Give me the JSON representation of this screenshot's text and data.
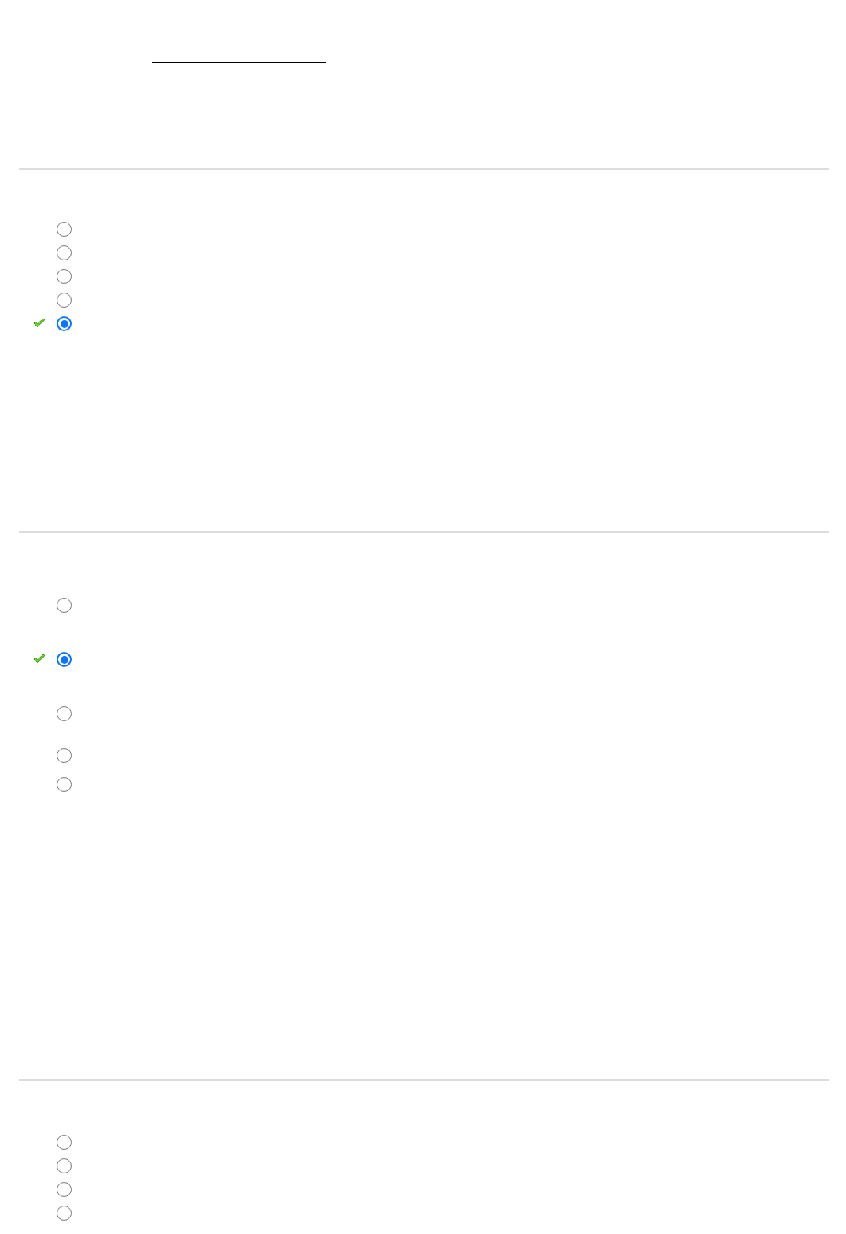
{
  "questions": [
    {
      "kind": "fill_in"
    },
    {
      "kind": "choice",
      "options": [
        {
          "selected": false,
          "marked_correct": false
        },
        {
          "selected": false,
          "marked_correct": false
        },
        {
          "selected": false,
          "marked_correct": false
        },
        {
          "selected": false,
          "marked_correct": false
        },
        {
          "selected": true,
          "marked_correct": true
        }
      ]
    },
    {
      "kind": "choice",
      "options": [
        {
          "selected": false,
          "marked_correct": false
        },
        {
          "selected": true,
          "marked_correct": true
        },
        {
          "selected": false,
          "marked_correct": false
        },
        {
          "selected": false,
          "marked_correct": false
        },
        {
          "selected": false,
          "marked_correct": false
        }
      ]
    },
    {
      "kind": "choice",
      "options": [
        {
          "selected": false,
          "marked_correct": false
        },
        {
          "selected": false,
          "marked_correct": false
        },
        {
          "selected": false,
          "marked_correct": false
        },
        {
          "selected": false,
          "marked_correct": false
        }
      ]
    }
  ]
}
